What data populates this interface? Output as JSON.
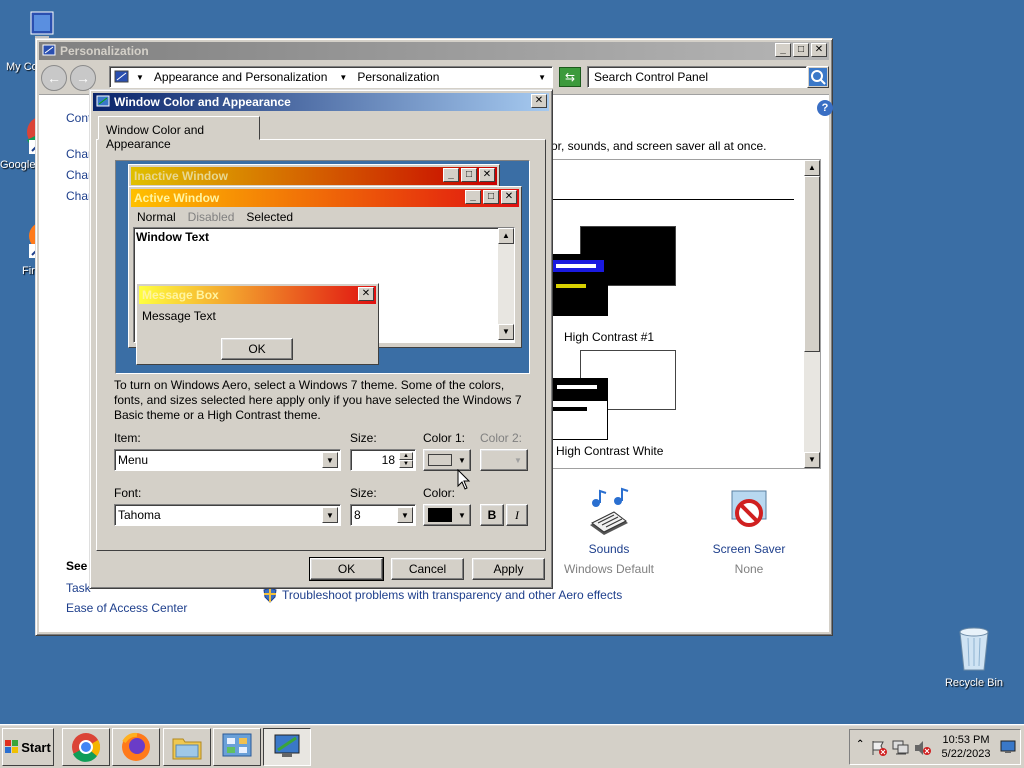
{
  "desktop": {
    "icons": [
      {
        "label": "My Co",
        "icon": "computer-icon"
      },
      {
        "label": "Google",
        "icon": "chrome-icon"
      },
      {
        "label": "Fir",
        "icon": "firefox-icon"
      },
      {
        "label": "Recycle Bin",
        "icon": "recycle-bin-icon"
      }
    ]
  },
  "personalization": {
    "title": "Personalization",
    "breadcrumb": [
      "Appearance and Personalization",
      "Personalization"
    ],
    "search_placeholder": "Search Control Panel",
    "left_partial": [
      "Cont",
      "Char",
      "Char",
      "Char"
    ],
    "intro_partial": "or, sounds, and screen saver all at once.",
    "themes": [
      {
        "label": "High Contrast #1"
      },
      {
        "label": "High Contrast White"
      }
    ],
    "see_also": {
      "heading": "See",
      "taskbar_partial": "Task",
      "ease_of_access": "Ease of Access Center"
    },
    "settings": [
      {
        "label": "Sounds",
        "value": "Windows Default",
        "icon": "sounds-icon"
      },
      {
        "label": "Screen Saver",
        "value": "None",
        "icon": "screen-saver-icon"
      }
    ],
    "troubleshoot": "Troubleshoot problems with transparency and other Aero effects"
  },
  "dialog": {
    "title": "Window Color and Appearance",
    "tab": "Window Color and Appearance",
    "preview": {
      "inactive_title": "Inactive Window",
      "active_title": "Active Window",
      "menu": [
        "Normal",
        "Disabled",
        "Selected"
      ],
      "window_text": "Window Text",
      "message_box_title": "Message Box",
      "message_text": "Message Text",
      "ok": "OK"
    },
    "info": "To turn on Windows Aero, select a Windows 7 theme.  Some of the colors, fonts, and sizes selected here apply only if you have selected the Windows 7 Basic theme or a High Contrast theme.",
    "item_label": "Item:",
    "item_value": "Menu",
    "size_label": "Size:",
    "size_value": "18",
    "color1_label": "Color 1:",
    "color2_label": "Color 2:",
    "font_label": "Font:",
    "font_value": "Tahoma",
    "font_size_label": "Size:",
    "font_size_value": "8",
    "font_color_label": "Color:",
    "bold": "B",
    "italic": "I",
    "buttons": {
      "ok": "OK",
      "cancel": "Cancel",
      "apply": "Apply"
    }
  },
  "taskbar": {
    "start": "Start",
    "time": "10:53 PM",
    "date": "5/22/2023"
  }
}
